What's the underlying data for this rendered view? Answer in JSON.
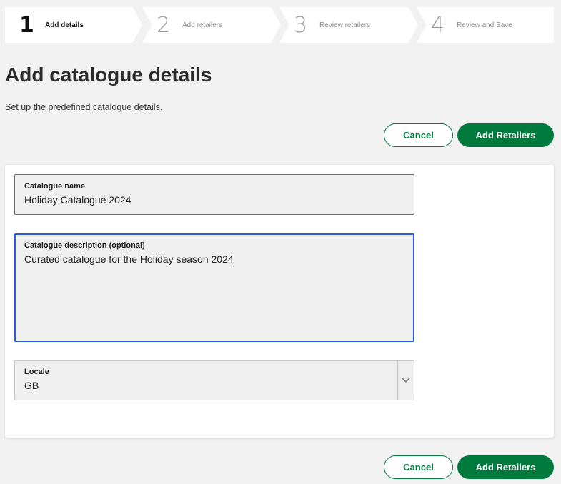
{
  "stepper": [
    {
      "num": "1",
      "label": "Add details",
      "active": true
    },
    {
      "num": "2",
      "label": "Add retailers"
    },
    {
      "num": "3",
      "label": "Review retailers"
    },
    {
      "num": "4",
      "label": "Review and Save"
    }
  ],
  "page": {
    "title": "Add catalogue details",
    "subtitle": "Set up the predefined catalogue details."
  },
  "actions": {
    "cancel": "Cancel",
    "add": "Add Retailers"
  },
  "form": {
    "name": {
      "label": "Catalogue name",
      "value": "Holiday Catalogue 2024"
    },
    "description": {
      "label": "Catalogue description (optional)",
      "value": "Curated catalogue for the Holiday season 2024"
    },
    "locale": {
      "label": "Locale",
      "value": "GB"
    }
  },
  "colors": {
    "primary": "#007a3d",
    "focus": "#2a5bd7"
  }
}
